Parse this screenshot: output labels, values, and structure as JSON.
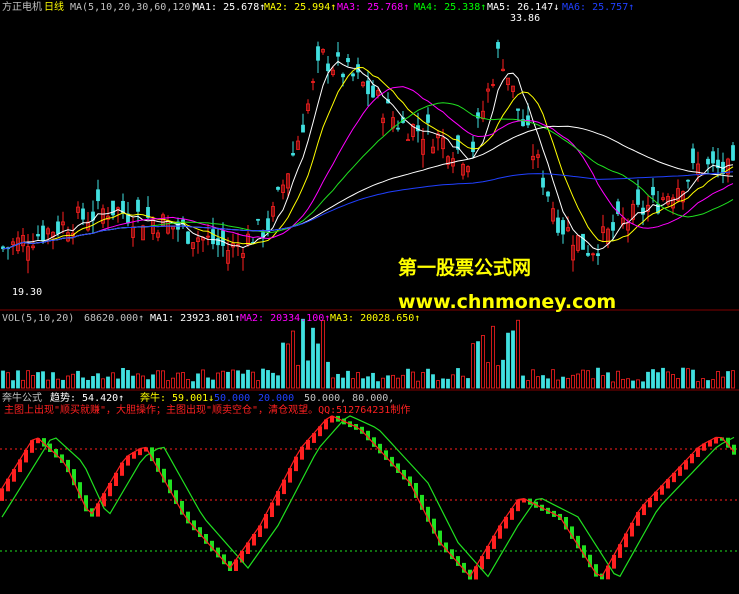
{
  "header": {
    "stock_name": "方正电机",
    "period": "日线",
    "ma_label": "MA(5,10,20,30,60,120)",
    "items": [
      {
        "text": "MA1: 25.678↑",
        "color": "#ffffff"
      },
      {
        "text": "MA2: 25.994↑",
        "color": "#ffff00"
      },
      {
        "text": "MA3: 25.768↑",
        "color": "#ff00ff"
      },
      {
        "text": "MA4: 25.338↑",
        "color": "#00ff00"
      },
      {
        "text": "MA5: 26.147↓",
        "color": "#ffffff"
      },
      {
        "text": "MA6: 25.757↑",
        "color": "#2040ff"
      }
    ]
  },
  "price_annotations": {
    "high": "33.86",
    "low": "19.30"
  },
  "watermark": {
    "line1": "第一股票公式网",
    "line2": "www.chnmoney.com"
  },
  "volume_header": {
    "label": "VOL(5,10,20)",
    "value": "68620.000↑",
    "items": [
      {
        "text": "MA1: 23923.801↑",
        "color": "#ffffff"
      },
      {
        "text": "MA2: 20334.100↑",
        "color": "#ff00ff"
      },
      {
        "text": "MA3: 20028.650↑",
        "color": "#ffff00"
      }
    ]
  },
  "indicator_header": {
    "label": "奔牛公式",
    "items": [
      {
        "text": "趋势: 54.420↑",
        "color": "#ffffff"
      },
      {
        "text": "奔牛: 59.001↓",
        "color": "#ffff00"
      },
      {
        "text": "50.000",
        "color": "#2040ff"
      },
      {
        "text": "20.000",
        "color": "#2040ff"
      },
      {
        "text": "50.000, 80.000,",
        "color": "#c0c0c0"
      }
    ],
    "note": "主图上出现\"顺买就赚\"，大胆操作；主图出现\"顺卖空仓\"，清仓观望。QQ:512764231制作"
  },
  "colors": {
    "up": "#ff2020",
    "down": "#40e0e0",
    "green": "#20e020",
    "blue": "#2040ff",
    "white": "#ffffff",
    "magenta": "#ff00ff",
    "yellow": "#ffff00",
    "grid": "#800000"
  },
  "chart_data": [
    {
      "type": "candlestick",
      "title": "方正电机 日线",
      "ylim": [
        18,
        35
      ],
      "annotations": [
        "33.86",
        "19.30"
      ],
      "series": [
        {
          "name": "MA1",
          "last": 25.678
        },
        {
          "name": "MA2",
          "last": 25.994
        },
        {
          "name": "MA3",
          "last": 25.768
        },
        {
          "name": "MA4",
          "last": 25.338
        },
        {
          "name": "MA5",
          "last": 26.147
        },
        {
          "name": "MA6",
          "last": 25.757
        }
      ]
    },
    {
      "type": "bar",
      "title": "VOL(5,10,20)",
      "last": 68620.0,
      "series": [
        {
          "name": "MA1",
          "last": 23923.801
        },
        {
          "name": "MA2",
          "last": 20334.1
        },
        {
          "name": "MA3",
          "last": 20028.65
        }
      ]
    },
    {
      "type": "line",
      "title": "奔牛公式",
      "ylim": [
        0,
        100
      ],
      "series": [
        {
          "name": "趋势",
          "last": 54.42
        },
        {
          "name": "奔牛",
          "last": 59.001
        }
      ],
      "reference_lines": [
        20,
        50,
        80
      ]
    }
  ]
}
